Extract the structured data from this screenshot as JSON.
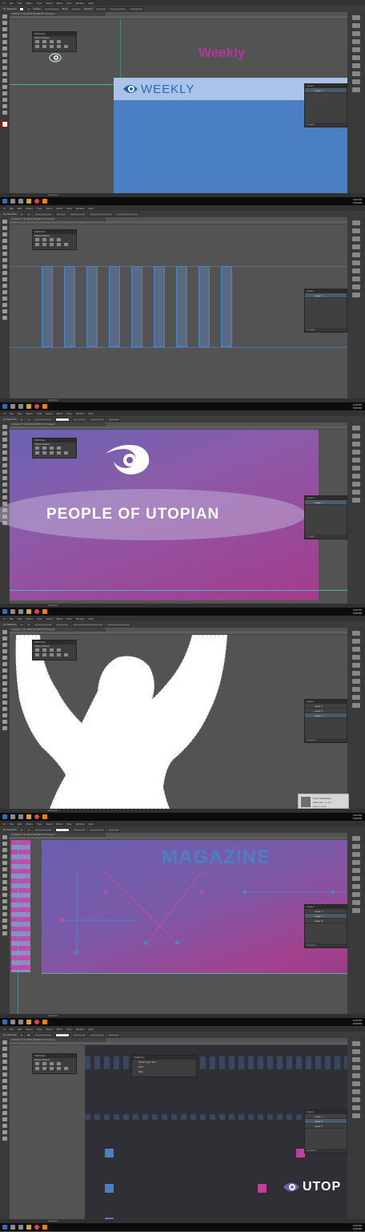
{
  "menu": [
    "Ai",
    "File",
    "Edit",
    "Object",
    "Type",
    "Select",
    "Effect",
    "View",
    "Window",
    "Help"
  ],
  "control_bar": {
    "selection": "No Selection",
    "stroke_label": "Stroke:",
    "style_label": "Style:",
    "opacity_label": "Opacity:",
    "doc_setup": "Document Setup",
    "preferences": "Preferences",
    "basic": "Basic",
    "pt": "3 pt. Round"
  },
  "workspace_label": "Essentials",
  "doc_tab": "Untitled-1* @ 100% (RGB/GPU Preview)",
  "pathfinder": {
    "tabs": [
      "Transform",
      "Align",
      "Pathfinder"
    ],
    "shape_modes": "Shape Modes:",
    "pathfinders": "Pathfinders:",
    "expand": "Expand"
  },
  "layers": {
    "title": "Layers",
    "count_1": "1 Layer",
    "count_3": "3 Layers",
    "rows": [
      "Layer 1",
      "Layer 2",
      "Layer 3"
    ]
  },
  "status": {
    "zoom": "100%",
    "tool": "Selection"
  },
  "tray": {
    "time": "3:20 PM",
    "date": "7/2/2018"
  },
  "frames": {
    "f1": {
      "title_pink": "Weekly",
      "logo_text": "WEEKLY"
    },
    "f3": {
      "banner": "PEOPLE OF UTOPIAN"
    },
    "f4": {
      "notify_name": "Toast Notification",
      "notify_line1": "Someone - 1 min",
      "notify_line2": "Click to view"
    },
    "f5": {
      "title": "MAGAZINE"
    },
    "f6": {
      "popup": {
        "title": "Character",
        "items": [
          "Touch Type Tool",
          "Font",
          "Size"
        ]
      },
      "logo_text": "UTOP"
    }
  },
  "colors": {
    "ui_bg": "#535353",
    "ai_orange": "#ff7c00",
    "weekly_blue": "#4a7fc4",
    "weekly_light": "#a9c4e8",
    "pink": "#b0399a",
    "magenta": "#a03b8a",
    "line_blue": "#4a86c8",
    "line_pink": "#c0409c"
  }
}
